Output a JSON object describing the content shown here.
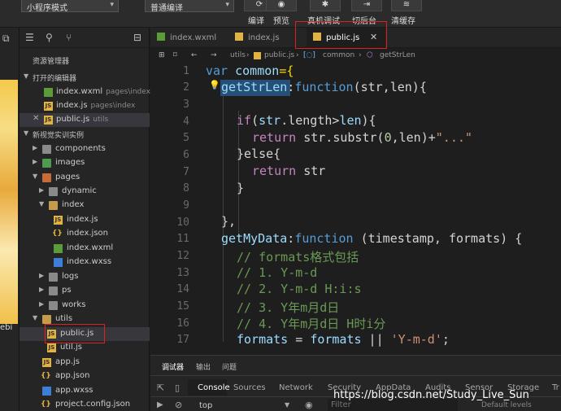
{
  "toolbar": {
    "mode_dropdown": "小程序模式",
    "compile_dropdown": "普通编译",
    "buttons": [
      "编译",
      "预览",
      "真机调试",
      "切后台",
      "清缓存"
    ]
  },
  "explorer": {
    "title": "资源管理器",
    "open_editors_header": "打开的编辑器",
    "open_editors": [
      {
        "name": "index.wxml",
        "path": "pages\\index"
      },
      {
        "name": "index.js",
        "path": "pages\\index"
      },
      {
        "name": "public.js",
        "path": "utils"
      }
    ],
    "project_header": "新视觉实训实例",
    "tree": [
      "components",
      "images",
      "pages",
      "dynamic",
      "index",
      "index.js",
      "index.json",
      "index.wxml",
      "index.wxss",
      "logs",
      "ps",
      "works",
      "utils",
      "public.js",
      "util.js",
      "app.js",
      "app.json",
      "app.wxss",
      "project.config.json"
    ]
  },
  "tabs": [
    "index.wxml",
    "index.js",
    "public.js"
  ],
  "breadcrumb": [
    "utils",
    "public.js",
    "common",
    "getStrLen"
  ],
  "code": {
    "line_numbers": [
      "1",
      "2",
      "3",
      "4",
      "5",
      "6",
      "7",
      "8",
      "9",
      "10",
      "11",
      "12",
      "13",
      "14",
      "15",
      "16",
      "17"
    ],
    "l1": {
      "kw": "var",
      "name": "common",
      "rest": "={"
    },
    "l2": {
      "name": "getStrLen",
      "colon": ":",
      "kw": "function",
      "args": "(str,len){"
    },
    "l4": {
      "kw": "if",
      "open": "(",
      "var": "str",
      "prop": ".length>",
      "var2": "len",
      "close": "){"
    },
    "l5": {
      "kw": "return",
      "expr": "str.substr(",
      "num": "0",
      "mid": ",len)+",
      "str": "\"...\""
    },
    "l6": {
      "text": "}else{"
    },
    "l7": {
      "kw": "return",
      "var": "str"
    },
    "l8": {
      "text": "}"
    },
    "l10": {
      "text": "},"
    },
    "l11": {
      "name": "getMyData",
      "colon": ":",
      "kw": "function",
      "args": "(timestamp, formats) {"
    },
    "l12": "// formats格式包括",
    "l13": "// 1. Y-m-d",
    "l14": "// 2. Y-m-d H:i:s",
    "l15": "// 3. Y年m月d日",
    "l16": "// 4. Y年m月d日 H时i分",
    "l17": {
      "var": "formats",
      "eq": " = ",
      "var2": "formats",
      "op": " || ",
      "str": "'Y-m-d'",
      "end": ";"
    }
  },
  "panel": {
    "tabs": [
      "调试器",
      "输出",
      "问题"
    ],
    "console_tabs": [
      "Console",
      "Sources",
      "Network",
      "Security",
      "AppData",
      "Audits",
      "Sensor",
      "Storage",
      "Tr"
    ],
    "context": "top",
    "filter_placeholder": "Filter",
    "levels": "Default levels"
  },
  "watermark": "https://blog.csdn.net/Study_Live_Sun",
  "edge_text": "ebi",
  "colors": {
    "highlight_box": "#e02020",
    "accent_js": "#e3b341"
  }
}
